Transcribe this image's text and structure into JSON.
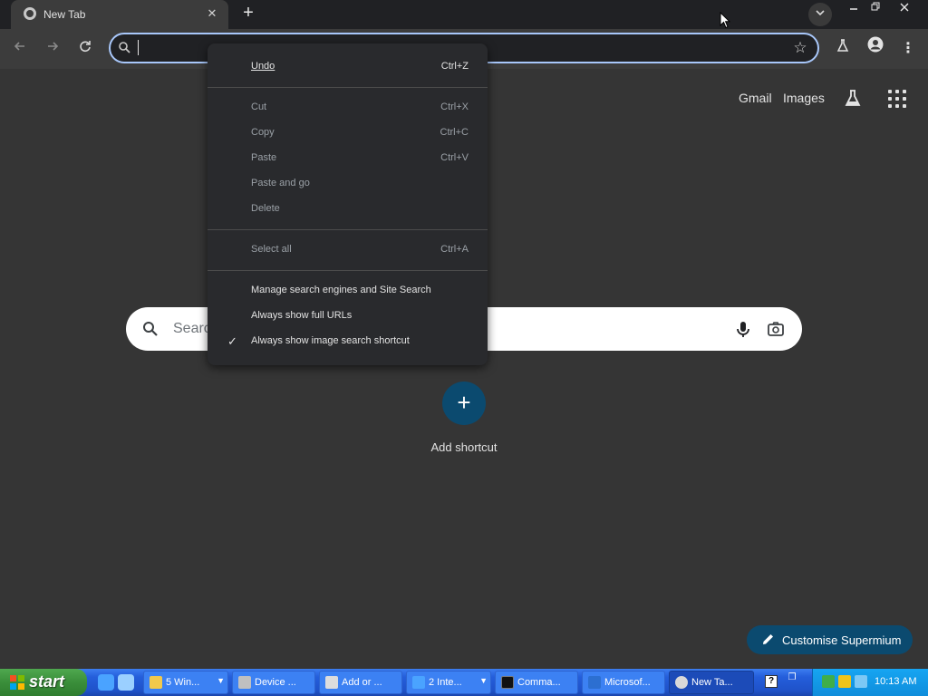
{
  "tab": {
    "title": "New Tab",
    "close_icon": "close-icon"
  },
  "window_controls": {
    "minimize": "—",
    "maximize": "❐",
    "close": "✕"
  },
  "omnibox": {
    "value": "",
    "placeholder": ""
  },
  "ntp": {
    "gmail": "Gmail",
    "images": "Images",
    "search_placeholder": "Searc",
    "add_shortcut": "Add shortcut",
    "customise": "Customise Supermium"
  },
  "context_menu": {
    "undo": {
      "label": "Undo",
      "shortcut": "Ctrl+Z"
    },
    "cut": {
      "label": "Cut",
      "shortcut": "Ctrl+X"
    },
    "copy": {
      "label": "Copy",
      "shortcut": "Ctrl+C"
    },
    "paste": {
      "label": "Paste",
      "shortcut": "Ctrl+V"
    },
    "paste_and_go": {
      "label": "Paste and go"
    },
    "delete": {
      "label": "Delete"
    },
    "select_all": {
      "label": "Select all",
      "shortcut": "Ctrl+A"
    },
    "manage_search": {
      "label": "Manage search engines and Site Search"
    },
    "full_urls": {
      "label": "Always show full URLs"
    },
    "image_search": {
      "label": "Always show image search shortcut",
      "checked": true
    }
  },
  "taskbar": {
    "start": "start",
    "items": [
      {
        "label": "5 Win...",
        "icon": "folder-icon",
        "color": "#f2c94c"
      },
      {
        "label": "Device ...",
        "icon": "device-manager-icon",
        "color": "#c0c0c0"
      },
      {
        "label": "Add or ...",
        "icon": "add-remove-programs-icon",
        "color": "#dddddd"
      },
      {
        "label": "2 Inte...",
        "icon": "ie-icon",
        "color": "#4aa3ff"
      },
      {
        "label": "Comma...",
        "icon": "cmd-icon",
        "color": "#111111"
      },
      {
        "label": "Microsof...",
        "icon": "microsoft-icon",
        "color": "#2c6fd1"
      },
      {
        "label": "New Ta...",
        "icon": "browser-icon",
        "color": "#d9d9d9"
      }
    ],
    "clock": "10:13 AM"
  },
  "colors": {
    "page_bg": "#353535",
    "accent": "#0b4a6f",
    "omnibox_focus": "#a8c7fa",
    "taskbar": "#245edb",
    "start": "#3a8e3a"
  }
}
